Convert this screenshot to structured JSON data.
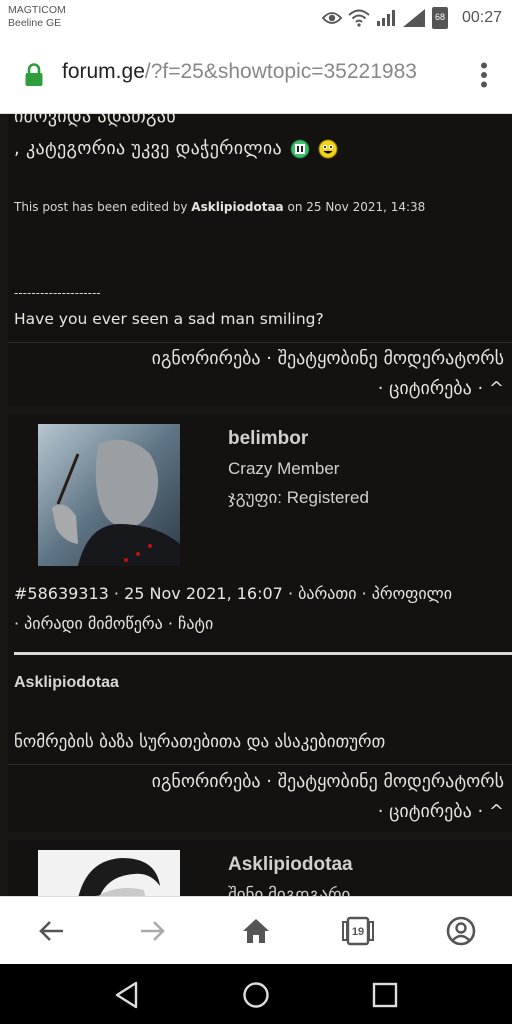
{
  "status": {
    "carrier_line1": "MAGTICOM",
    "carrier_line2": "Beeline GE",
    "battery": "68",
    "time": "00:27"
  },
  "browser": {
    "url_host": "forum.ge",
    "url_path": "/?f=25&showtopic=35221983",
    "tabs_count": "19"
  },
  "post1": {
    "text_line1": "იძოვიდა ადათგან",
    "text_line2": ", კატეგორია უკვე დაჭერილია",
    "edited_prefix": "This post has been edited by",
    "edited_user": "Asklipiodotaa",
    "edited_suffix": "on 25 Nov 2021, 14:38",
    "sig_separator": "--------------------",
    "signature": "Have you ever seen a sad man smiling?",
    "actions_line1": "იგნორირება · შეატყობინე მოდერატორს",
    "actions_line2": "· ციტირება · ^"
  },
  "post2": {
    "username": "belimbor",
    "rank": "Crazy Member",
    "group": "ჯგუფი: Registered",
    "meta_line1": "#58639313 · 25 Nov 2021, 16:07 · ბარათი · პროფილი",
    "meta_line2": "· პირადი მიმოწერა · ჩატი",
    "quote_author": "Asklipiodotaa",
    "quote_text": "ნომრების ბაზა სურათებითა და ასაკებითურთ",
    "actions_line1": "იგნორირება · შეატყობინე მოდერატორს",
    "actions_line2": "· ციტირება · ^"
  },
  "post3": {
    "username": "Asklipiodotaa",
    "rank": "შინი მიგდგარი"
  },
  "colors": {
    "background": "#191714",
    "card": "#141210",
    "lock_green": "#2e9e3c"
  }
}
